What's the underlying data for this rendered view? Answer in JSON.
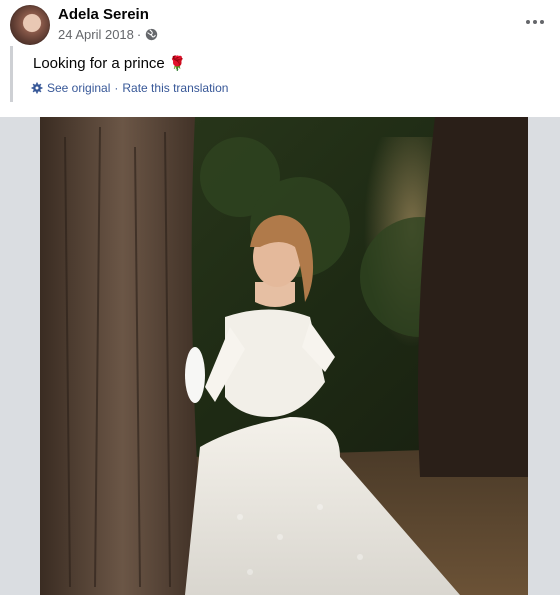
{
  "post": {
    "author": "Adela Serein",
    "date": "24 April 2018",
    "separator": "·",
    "privacy_icon": "globe-icon",
    "text": "Looking for a prince",
    "emoji": "🌹",
    "translation": {
      "gear_icon": "gear-icon",
      "see_original": "See original",
      "dot": "·",
      "rate": "Rate this translation"
    },
    "more_icon": "more-horizontal-icon",
    "photo_icon": "photo-woman-white-gown-by-tree"
  },
  "colors": {
    "link": "#385898",
    "meta": "#65676b",
    "frame_bg": "#dadde1"
  }
}
